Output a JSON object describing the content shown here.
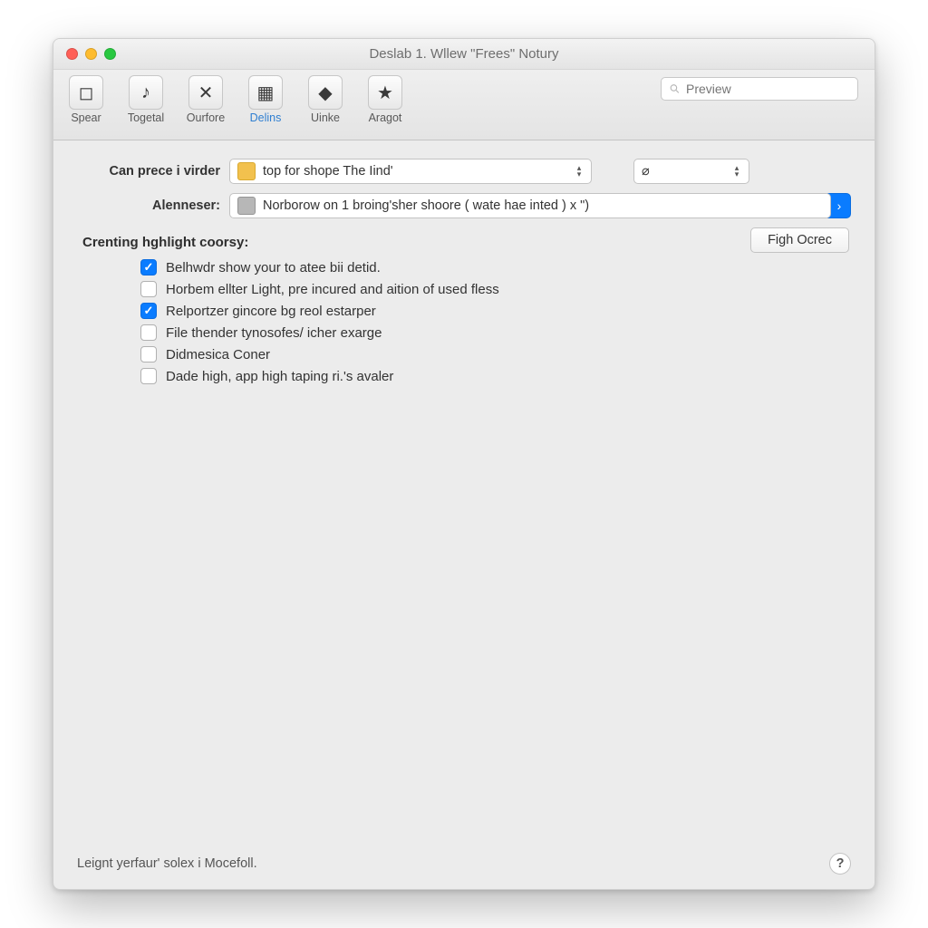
{
  "window": {
    "title": "Deslab 1. Wllew \"Frees\" Notury"
  },
  "search": {
    "placeholder": "Preview"
  },
  "tabs": [
    {
      "label": "Spear",
      "glyph": "◻"
    },
    {
      "label": "Togetal",
      "glyph": "♪"
    },
    {
      "label": "Ourfore",
      "glyph": "✕"
    },
    {
      "label": "Delins",
      "glyph": "▦",
      "active": true
    },
    {
      "label": "Uinke",
      "glyph": "◆"
    },
    {
      "label": "Aragot",
      "glyph": "★"
    }
  ],
  "form": {
    "row1_label": "Can prece i virder",
    "row1_value": "top for shope The Iind'",
    "row2_label": "Alenneser:",
    "row2_value": "Norborow on 1 broing'sher   shoore ( wate hae inted ) x \")",
    "secondary_value": "⌀"
  },
  "section_heading": "Crenting hghlight coorsy:",
  "checks": [
    {
      "label": "Belhwdr show your to atee bii detid.",
      "checked": true
    },
    {
      "label": "Horbem ellter Light, pre incured and aition of used fless",
      "checked": false
    },
    {
      "label": "Relportzer gincore bg reol estarper",
      "checked": true
    },
    {
      "label": "File thender tynosofes/ icher exarge",
      "checked": false
    },
    {
      "label": "Didmesica Coner",
      "checked": false
    },
    {
      "label": "Dade high, app high taping ri.'s avaler",
      "checked": false
    }
  ],
  "push_button": "Figh Ocrec",
  "footer_text": "Leignt yerfaur' solex i Mocefoll.",
  "help": "?"
}
